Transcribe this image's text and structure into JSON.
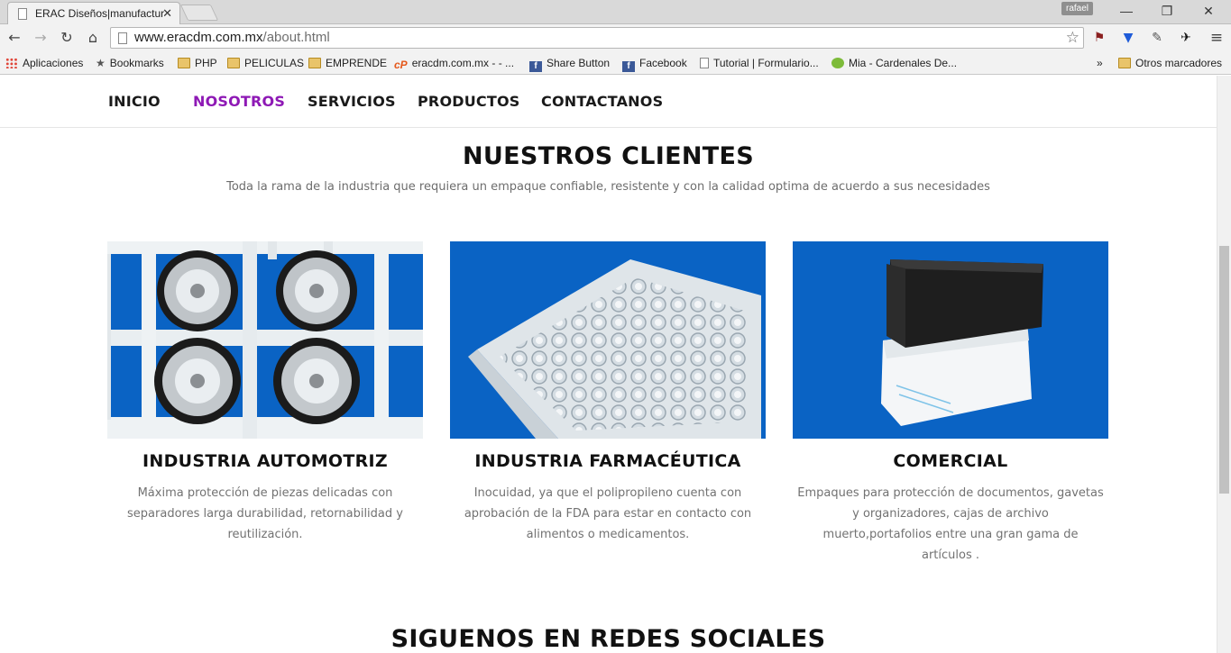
{
  "browser": {
    "tab_title": "ERAC Diseños|manufactur",
    "user": "rafael",
    "url_host": "www.eracdm.com.mx",
    "url_path": "/about.html",
    "bookmarks": [
      "Aplicaciones",
      "Bookmarks",
      "PHP",
      "PELICULAS",
      "EMPRENDE",
      "eracdm.com.mx - - ...",
      "Share Button",
      "Facebook",
      "Tutorial | Formulario...",
      "Mia - Cardenales De...",
      "»",
      "Otros marcadores"
    ]
  },
  "nav": {
    "items": [
      "INICIO",
      "NOSOTROS",
      "SERVICIOS",
      "PRODUCTOS",
      "CONTACTANOS"
    ],
    "active_color": "#8e19b5"
  },
  "clients": {
    "title": "NUESTROS CLIENTES",
    "subtitle": "Toda la rama de la industria que requiera un empaque confiable, resistente y con la calidad optima de acuerdo a sus necesidades",
    "cards": [
      {
        "title": "INDUSTRIA AUTOMOTRIZ",
        "text": "Máxima protección de piezas delicadas con separadores larga durabilidad, retornabilidad y reutilización."
      },
      {
        "title": "INDUSTRIA FARMACÉUTICA",
        "text": "Inocuidad, ya que el polipropileno cuenta con aprobación de la FDA para estar en contacto con alimentos o medicamentos."
      },
      {
        "title": "COMERCIAL",
        "text": "Empaques para protección de documentos, gavetas y organizadores, cajas de archivo muerto,portafolios entre una gran gama de artículos ."
      }
    ]
  },
  "social": {
    "title": "SIGUENOS EN REDES SOCIALES"
  },
  "colors": {
    "image_blue": "#0a63c4"
  }
}
